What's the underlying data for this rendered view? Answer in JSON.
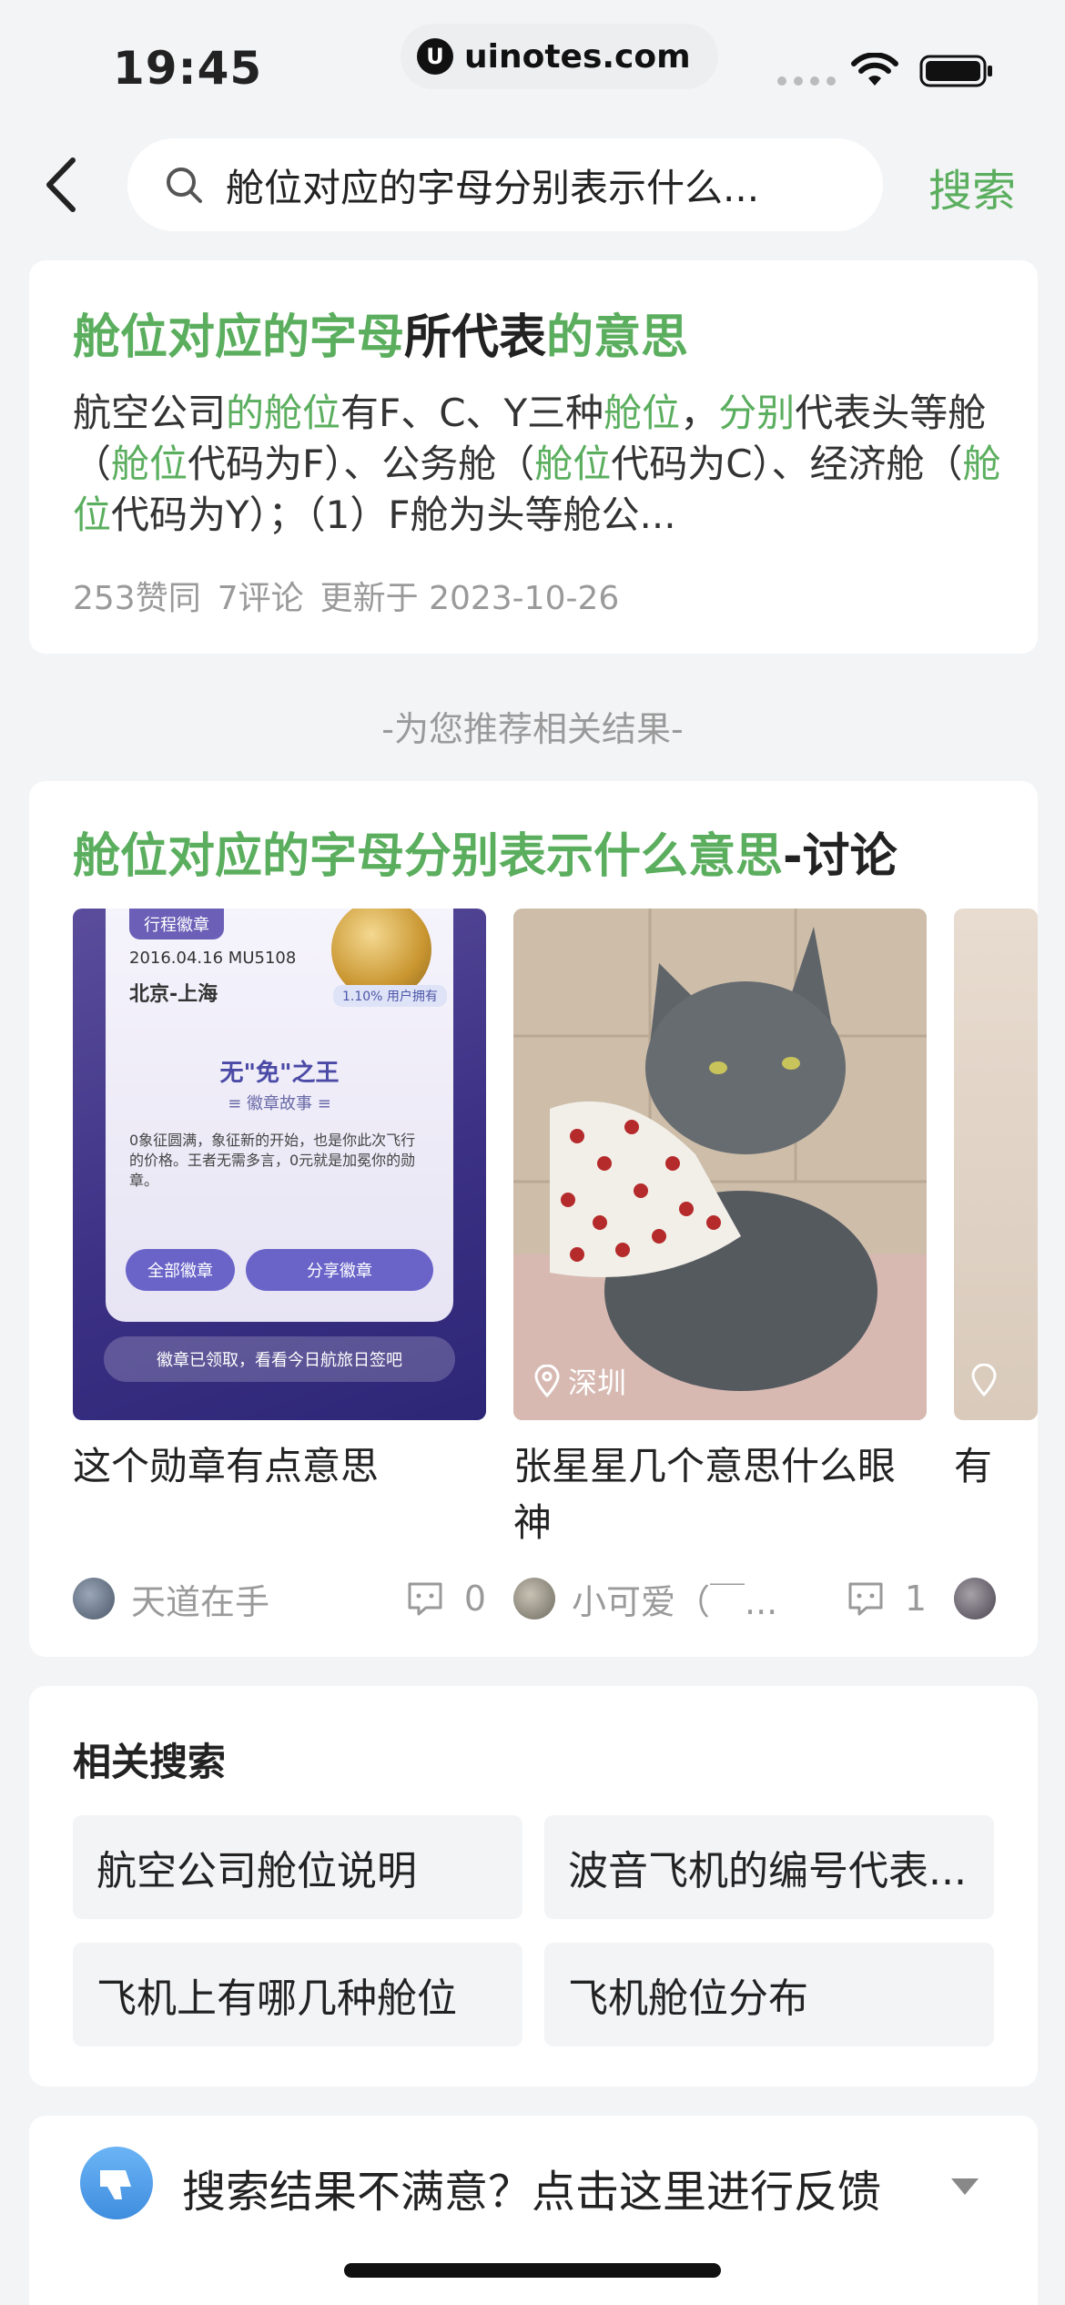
{
  "status_bar": {
    "time": "19:45",
    "url": "uinotes.com",
    "icons": [
      "wifi-icon",
      "battery-icon"
    ]
  },
  "search": {
    "query": "舱位对应的字母分别表示什么...",
    "button_label": "搜索"
  },
  "top_result": {
    "title_parts": [
      "舱位对应的字母",
      "所代表",
      "的意思"
    ],
    "body_parts": [
      "航空公司",
      "的舱位",
      "有F、C、Y三种",
      "舱位",
      "，",
      "分别",
      "代表头等舱（",
      "舱位",
      "代码为F）、公务舱（",
      "舱位",
      "代码为C）、经济舱（",
      "舱位",
      "代码为Y）；（1）F舱为头等舱公..."
    ],
    "likes": "253赞同",
    "comments": "7评论",
    "updated": "更新于 2023-10-26"
  },
  "recommend_divider": "-为您推荐相关结果-",
  "discussion": {
    "title_highlight": "舱位对应的字母分别表示什么意思",
    "title_suffix": "-讨论",
    "posts": [
      {
        "caption": "这个勋章有点意思",
        "author": "天道在手",
        "comment_count": "0",
        "badge": {
          "tag": "行程徽章",
          "date": "2016.04.16 MU5108",
          "route": "北京-上海",
          "percent": "1.10% 用户拥有",
          "name": "无\"免\"之王",
          "story": "≡ 徽章故事 ≡",
          "desc": "0象征圆满，象征新的开始，也是你此次飞行的价格。王者无需多言，0元就是加冕你的勋章。",
          "btn_all": "全部徽章",
          "btn_share": "分享徽章",
          "footer": "徽章已领取，看看今日航旅日签吧"
        }
      },
      {
        "caption": "张星星几个意思什么眼神",
        "author": "小可爱（￣...",
        "comment_count": "1",
        "location": "深圳"
      },
      {
        "caption": "有"
      }
    ]
  },
  "related": {
    "title": "相关搜索",
    "items": [
      "航空公司舱位说明",
      "波音飞机的编号代表...",
      "飞机上有哪几种舱位",
      "飞机舱位分布"
    ]
  },
  "feedback": {
    "text": "搜索结果不满意？点击这里进行反馈"
  },
  "colors": {
    "accent_green": "#5aae5e",
    "background": "#f3f4f6"
  }
}
